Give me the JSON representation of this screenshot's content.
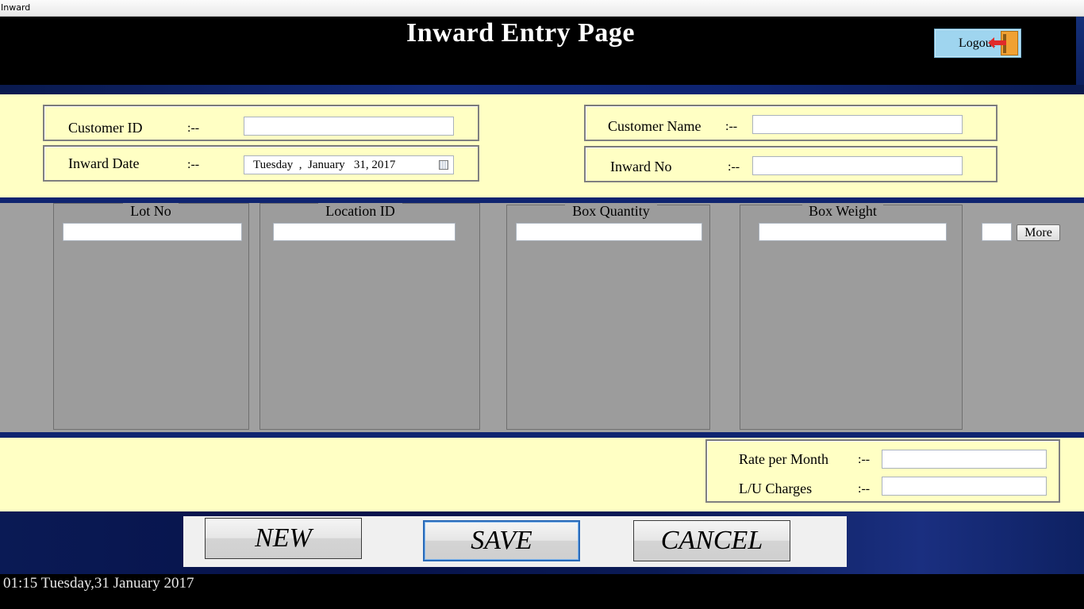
{
  "window": {
    "title": "Inward"
  },
  "header": {
    "title": "Inward Entry Page",
    "logout_label": "Logout"
  },
  "form": {
    "customer_id": {
      "label": "Customer ID",
      "sep": ":--",
      "value": ""
    },
    "inward_date": {
      "label": "Inward Date",
      "sep": ":--",
      "value": "Tuesday  ,  January   31, 2017"
    },
    "customer_name": {
      "label": "Customer Name",
      "sep": ":--",
      "value": ""
    },
    "inward_no": {
      "label": "Inward No",
      "sep": ":--",
      "value": ""
    }
  },
  "grid": {
    "columns": [
      {
        "header": "Lot No",
        "value": ""
      },
      {
        "header": "Location ID",
        "value": ""
      },
      {
        "header": "Box Quantity",
        "value": ""
      },
      {
        "header": "Box Weight",
        "value": ""
      }
    ],
    "count_value": "",
    "more_label": "More"
  },
  "charges": {
    "rate_per_month": {
      "label": "Rate per Month",
      "sep": ":--",
      "value": ""
    },
    "lu_charges": {
      "label": "L/U Charges",
      "sep": ":--",
      "value": ""
    }
  },
  "actions": {
    "new_label": "NEW",
    "save_label": "SAVE",
    "cancel_label": "CANCEL"
  },
  "status": {
    "datetime": "01:15 Tuesday,31 January 2017"
  },
  "colors": {
    "panel_yellow": "#ffffc4",
    "grid_gray": "#a0a0a0",
    "accent_blue": "#0f2470",
    "logout_blue": "#9fd5ef"
  }
}
